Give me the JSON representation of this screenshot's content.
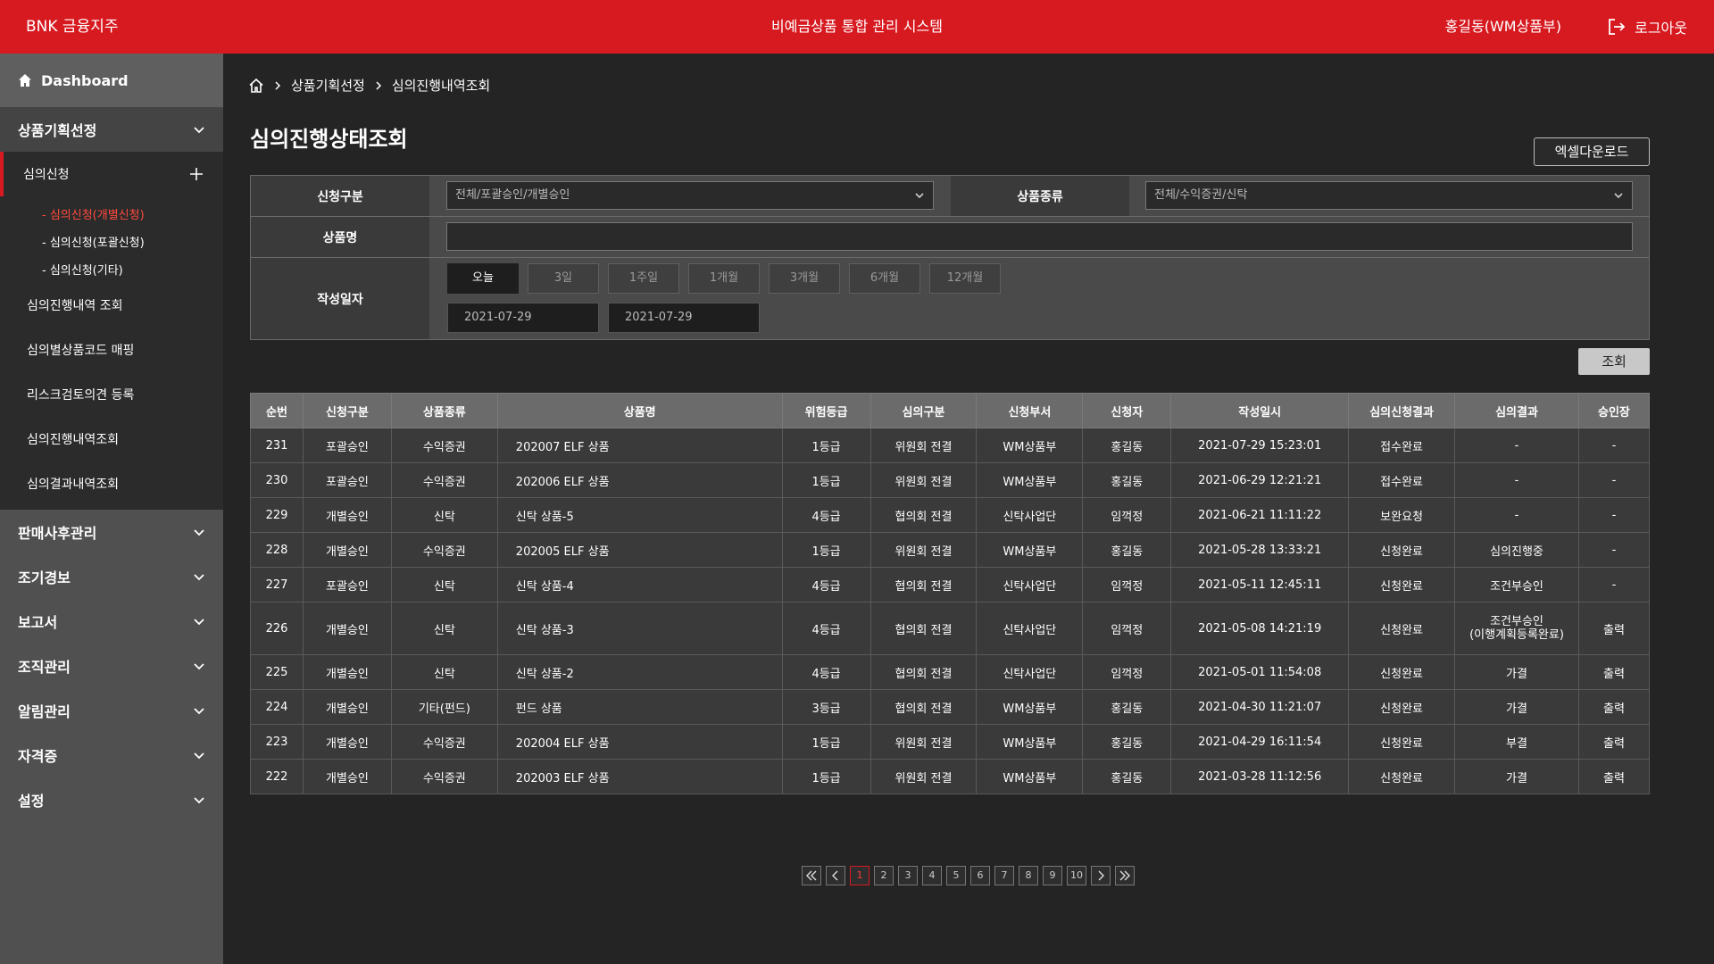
{
  "header": {
    "brand": "BNK 금융지주",
    "title": "비예금상품 통합 관리 시스템",
    "user": "홍길동(WM상품부)",
    "logout": "로그아웃"
  },
  "sidebar": {
    "dashboard": "Dashboard",
    "menu1": "상품기획선정",
    "open_sub": "심의신청",
    "sub3": [
      "- 심의신청(개별신청)",
      "- 심의신청(포괄신청)",
      "- 심의신청(기타)"
    ],
    "sub2": [
      "심의진행내역 조회",
      "심의별상품코드 매핑",
      "리스크검토의견 등록",
      "심의진행내역조회",
      "심의결과내역조회"
    ],
    "menus": [
      "판매사후관리",
      "조기경보",
      "보고서",
      "조직관리",
      "알림관리",
      "자격증",
      "설정"
    ]
  },
  "breadcrumb": [
    "상품기획선정",
    "심의진행내역조회"
  ],
  "page_title": "심의진행상태조회",
  "excel_button": "엑셀다운로드",
  "form": {
    "apply_type_label": "신청구분",
    "apply_type_value": "전체/포괄승인/개별승인",
    "product_type_label": "상품종류",
    "product_type_value": "전체/수익증권/신탁",
    "product_name_label": "상품명",
    "product_name_value": "",
    "date_label": "작성일자",
    "periods": [
      "오늘",
      "3일",
      "1주일",
      "1개월",
      "3개월",
      "6개월",
      "12개월"
    ],
    "date_from": "2021-07-29",
    "date_to": "2021-07-29"
  },
  "search_button": "조회",
  "table": {
    "columns": [
      "순번",
      "신청구분",
      "상품종류",
      "상품명",
      "위험등급",
      "심의구분",
      "신청부서",
      "신청자",
      "작성일시",
      "심의신청결과",
      "심의결과",
      "승인장"
    ],
    "rows": [
      [
        "231",
        "포괄승인",
        "수익증권",
        "202007 ELF 상품",
        "1등급",
        "위원회 전결",
        "WM상품부",
        "홍길동",
        "2021-07-29  15:23:01",
        "접수완료",
        "-",
        "-"
      ],
      [
        "230",
        "포괄승인",
        "수익증권",
        "202006 ELF 상품",
        "1등급",
        "위원회 전결",
        "WM상품부",
        "홍길동",
        "2021-06-29  12:21:21",
        "접수완료",
        "-",
        "-"
      ],
      [
        "229",
        "개별승인",
        "신탁",
        "신탁 상품-5",
        "4등급",
        "협의회 전결",
        "신탁사업단",
        "임꺽정",
        "2021-06-21  11:11:22",
        "보완요청",
        "-",
        "-"
      ],
      [
        "228",
        "개별승인",
        "수익증권",
        "202005 ELF 상품",
        "1등급",
        "위원회 전결",
        "WM상품부",
        "홍길동",
        "2021-05-28  13:33:21",
        "신청완료",
        "심의진행중",
        "-"
      ],
      [
        "227",
        "포괄승인",
        "신탁",
        "신탁 상품-4",
        "4등급",
        "협의회 전결",
        "신탁사업단",
        "임꺽정",
        "2021-05-11  12:45:11",
        "신청완료",
        "조건부승인",
        "-"
      ],
      [
        "226",
        "개별승인",
        "신탁",
        "신탁 상품-3",
        "4등급",
        "협의회 전결",
        "신탁사업단",
        "임꺽정",
        "2021-05-08  14:21:19",
        "신청완료",
        "조건부승인\n(이행계획등록완료)",
        "출력"
      ],
      [
        "225",
        "개별승인",
        "신탁",
        "신탁 상품-2",
        "4등급",
        "협의회 전결",
        "신탁사업단",
        "임꺽정",
        "2021-05-01  11:54:08",
        "신청완료",
        "가결",
        "출력"
      ],
      [
        "224",
        "개별승인",
        "기타(펀드)",
        "펀드 상품",
        "3등급",
        "협의회 전결",
        "WM상품부",
        "홍길동",
        "2021-04-30  11:21:07",
        "신청완료",
        "가결",
        "출력"
      ],
      [
        "223",
        "개별승인",
        "수익증권",
        "202004 ELF 상품",
        "1등급",
        "위원회 전결",
        "WM상품부",
        "홍길동",
        "2021-04-29  16:11:54",
        "신청완료",
        "부결",
        "출력"
      ],
      [
        "222",
        "개별승인",
        "수익증권",
        "202003 ELF 상품",
        "1등급",
        "위원회 전결",
        "WM상품부",
        "홍길동",
        "2021-03-28  11:12:56",
        "신청완료",
        "가결",
        "출력"
      ]
    ]
  },
  "pagination": {
    "pages": [
      "1",
      "2",
      "3",
      "4",
      "5",
      "6",
      "7",
      "8",
      "9",
      "10"
    ],
    "current": "1"
  },
  "colors": {
    "brand_red": "#d71920",
    "sidebar": "#505050",
    "background": "#242424",
    "active_menu": "#ff4a3d"
  }
}
